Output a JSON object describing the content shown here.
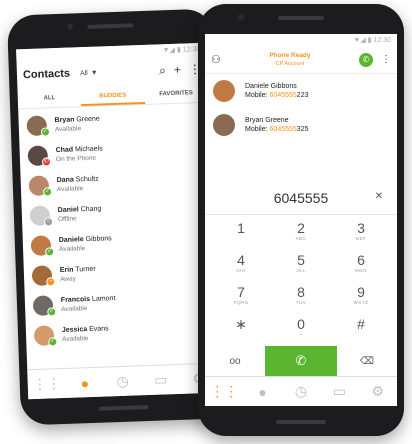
{
  "left": {
    "status_text": "▼◢ ▮ 12:30",
    "header": {
      "title": "Contacts",
      "filter": "All"
    },
    "tabs": [
      "ALL",
      "BUDDIES",
      "FAVORITES"
    ],
    "contacts": [
      {
        "first": "Bryan",
        "last": "Greene",
        "status": "Available",
        "presence": "available",
        "avatar_color": "#8a6a52"
      },
      {
        "first": "Chad",
        "last": "Michaels",
        "status": "On the Phone",
        "presence": "busy",
        "avatar_color": "#5a4a46"
      },
      {
        "first": "Dana",
        "last": "Schultz",
        "status": "Available",
        "presence": "available",
        "avatar_color": "#b9876a"
      },
      {
        "first": "Daniel",
        "last": "Chang",
        "status": "Offline",
        "presence": "offline",
        "avatar_color": "#cfcfcf"
      },
      {
        "first": "Daniele",
        "last": "Gibbons",
        "status": "Available",
        "presence": "available",
        "avatar_color": "#c27a45"
      },
      {
        "first": "Erin",
        "last": "Turner",
        "status": "Away",
        "presence": "away",
        "avatar_color": "#a36a3a"
      },
      {
        "first": "Francois",
        "last": "Lamont",
        "status": "Available",
        "presence": "available",
        "avatar_color": "#6f6a66"
      },
      {
        "first": "Jessica",
        "last": "Evans",
        "status": "Available",
        "presence": "available",
        "avatar_color": "#d59a6a"
      }
    ],
    "tabbar": [
      {
        "icon": "dialpad-icon",
        "glyph": "⋮⋮"
      },
      {
        "icon": "contacts-icon",
        "glyph": "●"
      },
      {
        "icon": "history-icon",
        "glyph": "◷"
      },
      {
        "icon": "messages-icon",
        "glyph": "▭"
      },
      {
        "icon": "settings-icon",
        "glyph": "⚙"
      }
    ]
  },
  "right": {
    "status_text": "▼◢ ▮ 12:30",
    "header": {
      "state": "Phone Ready",
      "account": "CP Account"
    },
    "matches": [
      {
        "name": "Daniele Gibbons",
        "phone_label": "Mobile:",
        "phone_match": "6045555",
        "phone_rest": "223",
        "avatar_color": "#c27a45"
      },
      {
        "name": "Bryan Greene",
        "phone_label": "Mobile:",
        "phone_match": "6045555",
        "phone_rest": "325",
        "avatar_color": "#8a6a52"
      }
    ],
    "dialed_number": "6045555",
    "keys": [
      {
        "digit": "1",
        "letters": ""
      },
      {
        "digit": "2",
        "letters": "ABC"
      },
      {
        "digit": "3",
        "letters": "DEF"
      },
      {
        "digit": "4",
        "letters": "GHI"
      },
      {
        "digit": "5",
        "letters": "JKL"
      },
      {
        "digit": "6",
        "letters": "MNO"
      },
      {
        "digit": "7",
        "letters": "PQRS"
      },
      {
        "digit": "8",
        "letters": "TUV"
      },
      {
        "digit": "9",
        "letters": "WXYZ"
      },
      {
        "digit": "∗",
        "letters": ""
      },
      {
        "digit": "0",
        "letters": "+"
      },
      {
        "digit": "#",
        "letters": ""
      }
    ],
    "accent_color": "#f7941d",
    "call_color": "#5cb531"
  }
}
